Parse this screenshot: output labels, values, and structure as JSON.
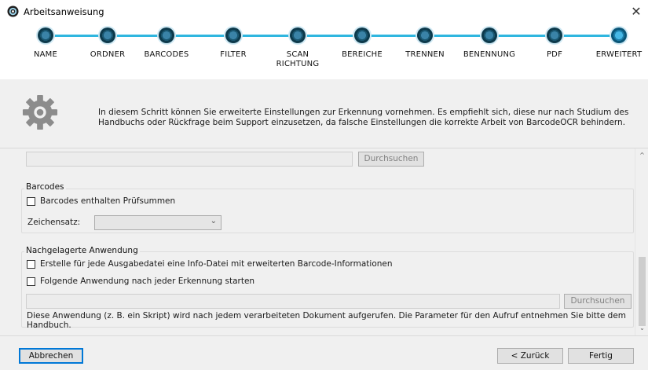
{
  "window": {
    "title": "Arbeitsanweisung",
    "close_glyph": "✕"
  },
  "steps": [
    {
      "label": "NAME",
      "active": false
    },
    {
      "label": "ORDNER",
      "active": false
    },
    {
      "label": "BARCODES",
      "active": false
    },
    {
      "label": "FILTER",
      "active": false
    },
    {
      "label": "SCAN\nRICHTUNG",
      "active": false
    },
    {
      "label": "BEREICHE",
      "active": false
    },
    {
      "label": "TRENNEN",
      "active": false
    },
    {
      "label": "BENENNUNG",
      "active": false
    },
    {
      "label": "PDF",
      "active": false
    },
    {
      "label": "ERWEITERT",
      "active": true
    }
  ],
  "info": {
    "icon": "gear-icon",
    "text": "In diesem Schritt können Sie erweiterte Einstellungen zur Erkennung vornehmen. Es empfiehlt sich, diese nur nach Studium des Handbuchs oder Rückfrage beim Support einzusetzen, da falsche Einstellungen die korrekte Arbeit von BarcodeOCR behindern."
  },
  "top_path": {
    "value": "",
    "browse_label": "Durchsuchen"
  },
  "barcodes_group": {
    "title": "Barcodes",
    "checksum_label": "Barcodes enthalten Prüfsummen",
    "checksum_checked": false,
    "charset_label": "Zeichensatz:",
    "charset_value": ""
  },
  "post_app_group": {
    "title": "Nachgelagerte Anwendung",
    "info_file_label": "Erstelle für jede Ausgabedatei eine Info-Datei mit erweiterten Barcode-Informationen",
    "info_file_checked": false,
    "run_app_label": "Folgende Anwendung nach jeder Erkennung starten",
    "run_app_checked": false,
    "app_path": "",
    "browse_label": "Durchsuchen",
    "description": "Diese Anwendung (z. B. ein Skript) wird nach jedem verarbeiteten Dokument aufgerufen. Die Parameter für den Aufruf entnehmen Sie bitte dem Handbuch."
  },
  "footer": {
    "cancel_label": "Abbrechen",
    "back_label": "< Zurück",
    "finish_label": "Fertig"
  },
  "colors": {
    "accent": "#2fb6df",
    "step_dot": "#19566f",
    "focus": "#0078d7"
  }
}
